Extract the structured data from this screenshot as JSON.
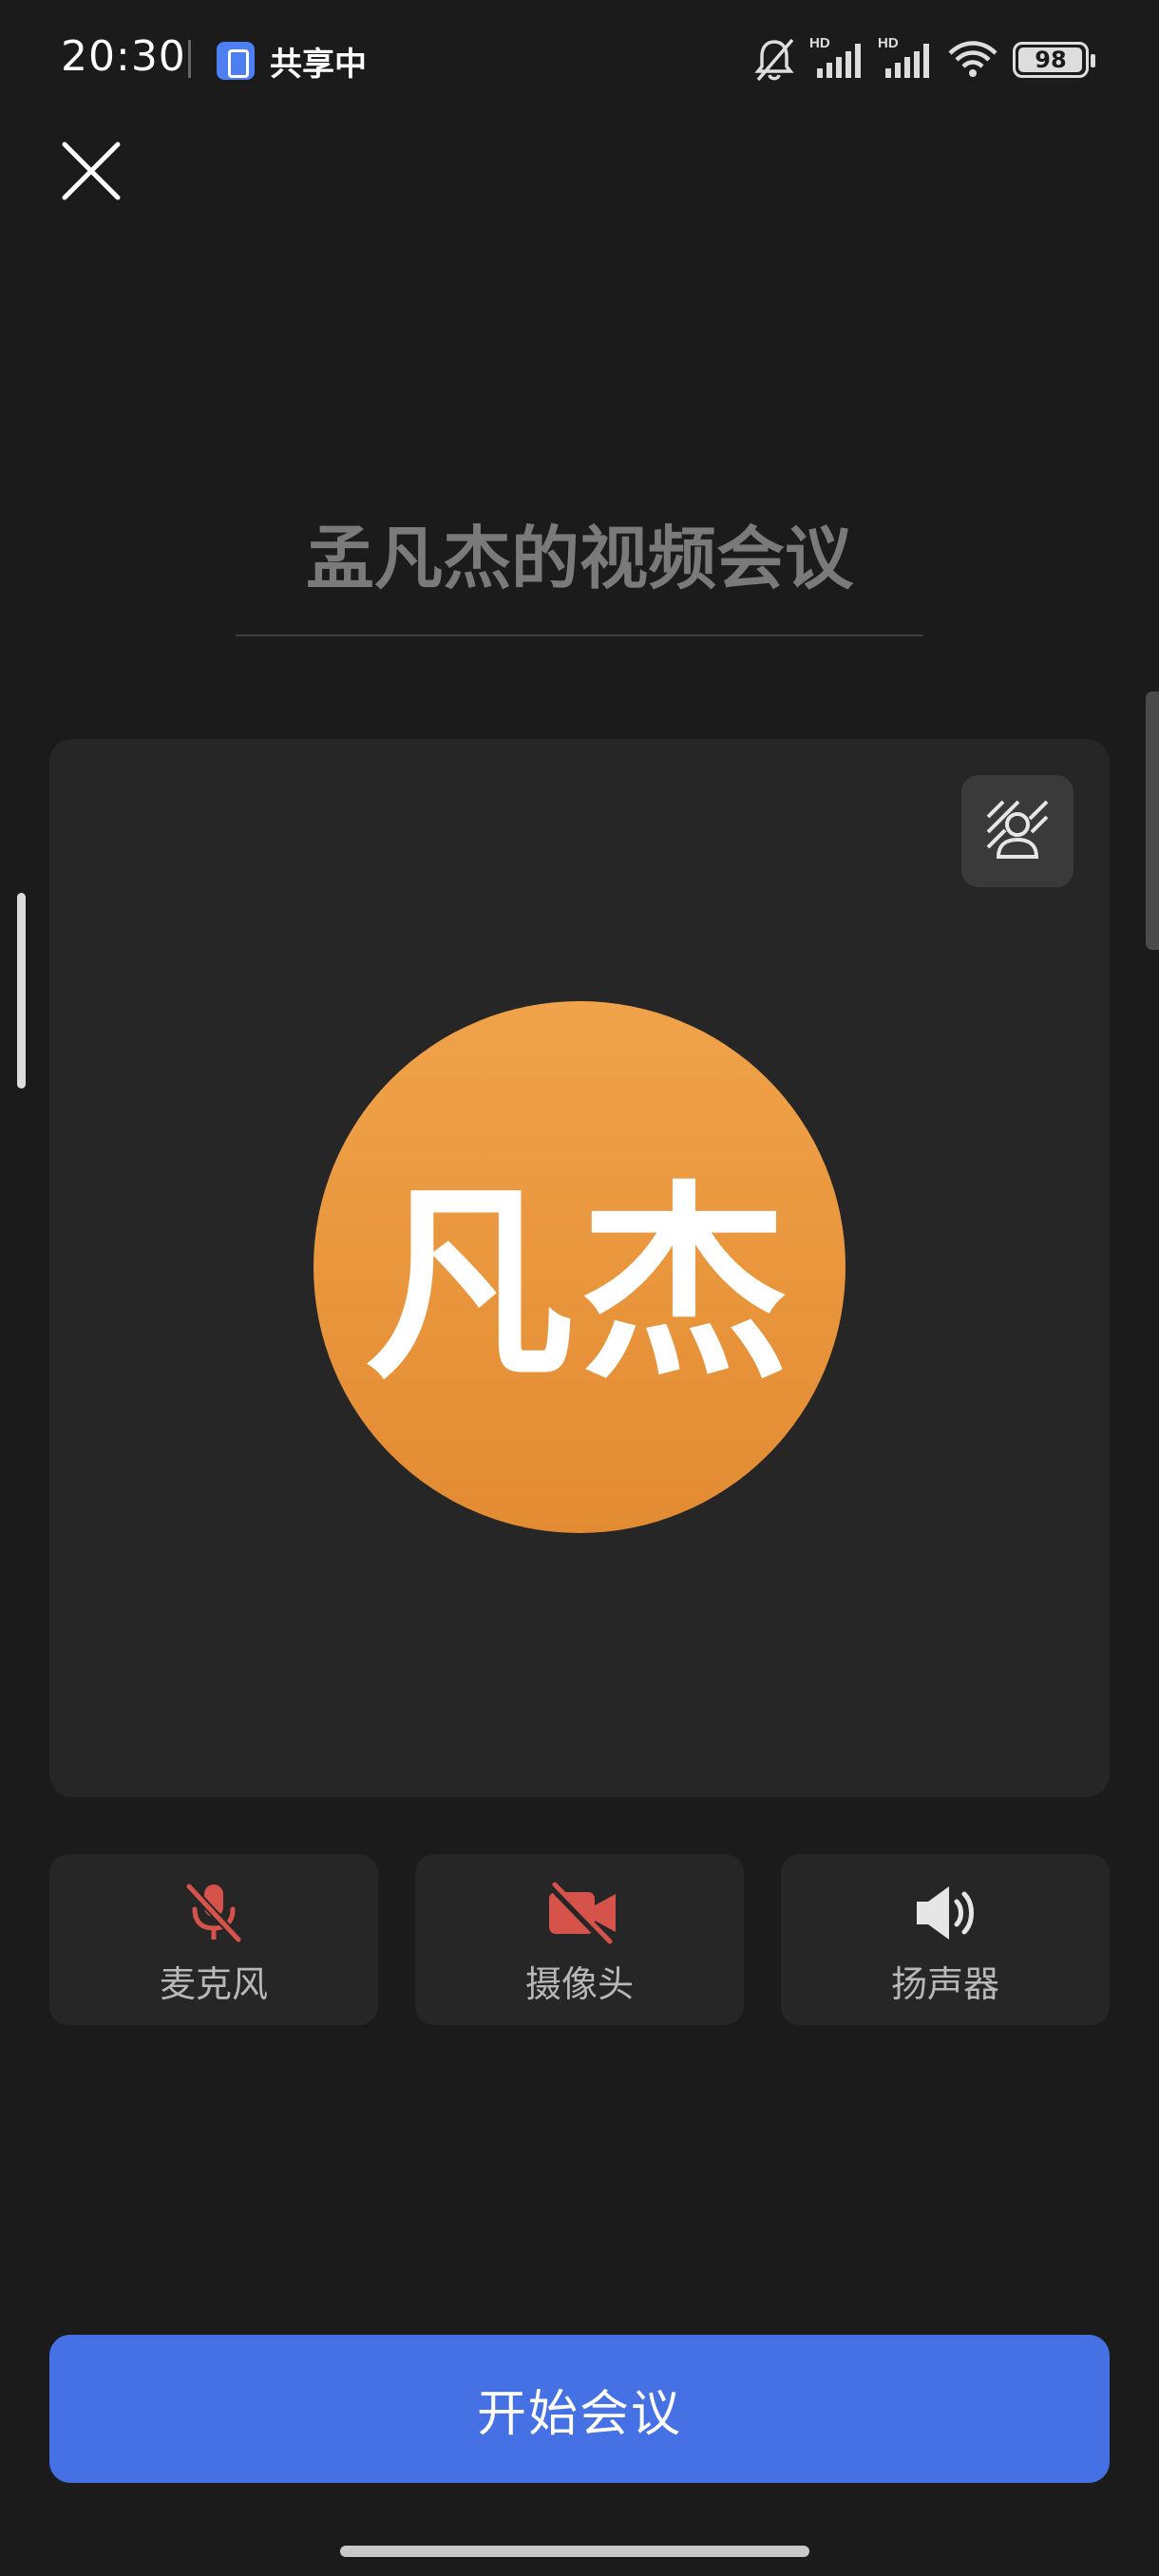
{
  "status_bar": {
    "time": "20:30",
    "share_text": "共享中",
    "battery_percent": 98,
    "battery_text": "98"
  },
  "meeting": {
    "title": "孟凡杰的视频会议",
    "avatar_text": "凡杰"
  },
  "controls": {
    "microphone_label": "麦克风",
    "camera_label": "摄像头",
    "speaker_label": "扬声器"
  },
  "actions": {
    "start_label": "开始会议"
  },
  "colors": {
    "background": "#1b1b1c",
    "panel": "#262627",
    "avatar": "#ed9c43",
    "muted_red": "#d6534c",
    "primary_blue": "#4671e5"
  }
}
